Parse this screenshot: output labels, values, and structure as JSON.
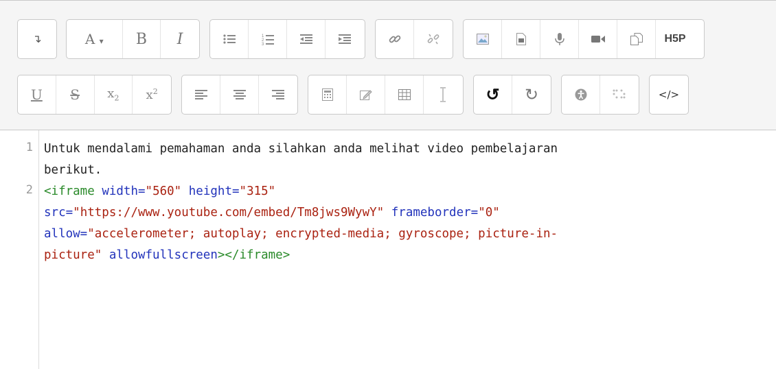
{
  "toolbar": {
    "row1": [
      {
        "name": "toggle-toolbar-button",
        "icon": "arrow-down-icon",
        "glyph": "↴"
      },
      {
        "name": "font-style-button",
        "icon": "font-dropdown-icon",
        "glyph": "A ▾"
      },
      {
        "name": "bold-button",
        "icon": "bold-icon",
        "glyph": "B"
      },
      {
        "name": "italic-button",
        "icon": "italic-icon",
        "glyph": "I"
      },
      {
        "name": "unordered-list-button",
        "icon": "bullet-list-icon"
      },
      {
        "name": "ordered-list-button",
        "icon": "numbered-list-icon"
      },
      {
        "name": "outdent-button",
        "icon": "outdent-icon"
      },
      {
        "name": "indent-button",
        "icon": "indent-icon"
      },
      {
        "name": "link-button",
        "icon": "link-icon"
      },
      {
        "name": "unlink-button",
        "icon": "unlink-icon"
      },
      {
        "name": "insert-image-button",
        "icon": "image-icon"
      },
      {
        "name": "insert-media-button",
        "icon": "media-file-icon"
      },
      {
        "name": "record-audio-button",
        "icon": "microphone-icon"
      },
      {
        "name": "record-video-button",
        "icon": "video-camera-icon"
      },
      {
        "name": "manage-files-button",
        "icon": "files-icon"
      },
      {
        "name": "h5p-button",
        "icon": "h5p-icon",
        "glyph": "H5P"
      }
    ],
    "row2": [
      {
        "name": "underline-button",
        "icon": "underline-icon",
        "glyph": "U"
      },
      {
        "name": "strikethrough-button",
        "icon": "strikethrough-icon",
        "glyph": "S"
      },
      {
        "name": "subscript-button",
        "icon": "subscript-icon",
        "glyph": "x₂"
      },
      {
        "name": "superscript-button",
        "icon": "superscript-icon",
        "glyph": "x²"
      },
      {
        "name": "align-left-button",
        "icon": "align-left-icon"
      },
      {
        "name": "align-center-button",
        "icon": "align-center-icon"
      },
      {
        "name": "align-right-button",
        "icon": "align-right-icon"
      },
      {
        "name": "equation-button",
        "icon": "calculator-icon"
      },
      {
        "name": "insert-special-character-button",
        "icon": "edit-icon"
      },
      {
        "name": "table-button",
        "icon": "table-icon"
      },
      {
        "name": "clear-formatting-button",
        "icon": "text-cursor-icon",
        "glyph": "I"
      },
      {
        "name": "undo-button",
        "icon": "undo-icon",
        "glyph": "↺"
      },
      {
        "name": "redo-button",
        "icon": "redo-icon",
        "glyph": "↻"
      },
      {
        "name": "accessibility-checker-button",
        "icon": "accessibility-icon"
      },
      {
        "name": "screenreader-helper-button",
        "icon": "braille-icon"
      },
      {
        "name": "html-source-button",
        "icon": "code-icon",
        "glyph": "</>"
      }
    ]
  },
  "editor": {
    "line_numbers": [
      "1",
      "2"
    ],
    "lines": [
      {
        "segments": [
          {
            "t": "plain",
            "v": "Untuk mendalami pemahaman anda silahkan anda melihat video pembelajaran"
          }
        ]
      },
      {
        "segments": [
          {
            "t": "plain",
            "v": "berikut."
          }
        ]
      },
      {
        "segments": [
          {
            "t": "tag",
            "v": "<iframe"
          },
          {
            "t": "plain",
            "v": " "
          },
          {
            "t": "attr",
            "v": "width="
          },
          {
            "t": "str",
            "v": "\"560\""
          },
          {
            "t": "plain",
            "v": " "
          },
          {
            "t": "attr",
            "v": "height="
          },
          {
            "t": "str",
            "v": "\"315\""
          }
        ]
      },
      {
        "segments": [
          {
            "t": "attr",
            "v": "src="
          },
          {
            "t": "str",
            "v": "\"https://www.youtube.com/embed/Tm8jws9WywY\""
          },
          {
            "t": "plain",
            "v": " "
          },
          {
            "t": "attr",
            "v": "frameborder="
          },
          {
            "t": "str",
            "v": "\"0\""
          }
        ]
      },
      {
        "segments": [
          {
            "t": "attr",
            "v": "allow="
          },
          {
            "t": "str",
            "v": "\"accelerometer; autoplay; encrypted-media; gyroscope; picture-in-"
          }
        ]
      },
      {
        "segments": [
          {
            "t": "str",
            "v": "picture\""
          },
          {
            "t": "plain",
            "v": " "
          },
          {
            "t": "attr",
            "v": "allowfullscreen"
          },
          {
            "t": "tag",
            "v": "></iframe>"
          }
        ]
      }
    ]
  }
}
